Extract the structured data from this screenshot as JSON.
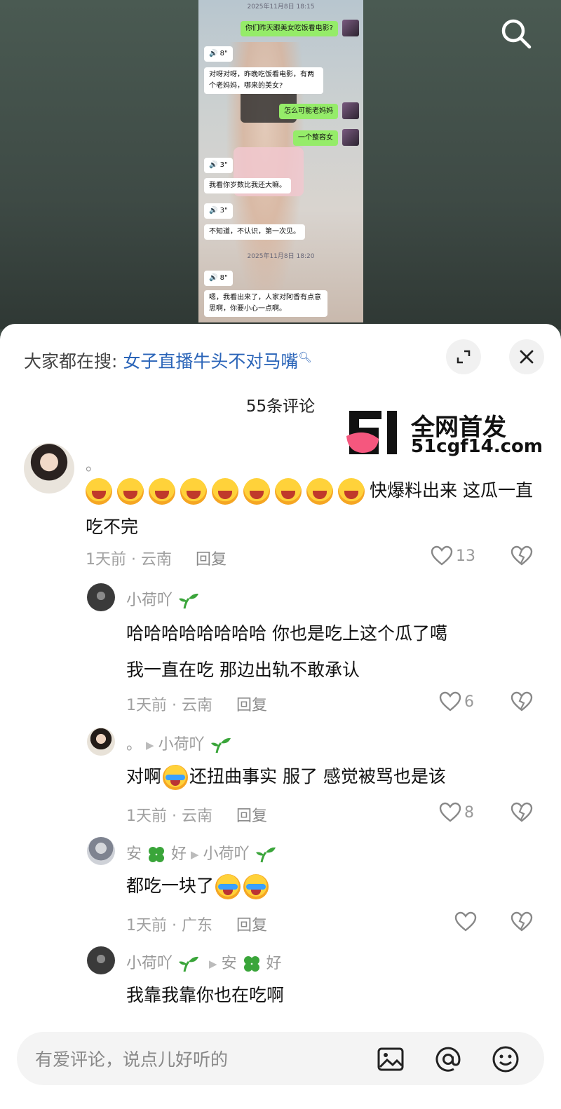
{
  "video": {
    "chat": {
      "timestamps": [
        "2025年11月8日 18:15",
        "2025年11月8日 18:20"
      ],
      "messages": [
        {
          "side": "right",
          "text": "你们昨天跟美女吃饭看电影?"
        },
        {
          "side": "left",
          "text": "🔊 8\""
        },
        {
          "side": "left",
          "text": "对呀对呀，昨晚吃饭看电影，有两个老妈妈，哪来的美女?"
        },
        {
          "side": "right",
          "text": "怎么可能老妈妈"
        },
        {
          "side": "right",
          "text": "一个整容女"
        },
        {
          "side": "left",
          "text": "🔊 3\""
        },
        {
          "side": "left",
          "text": "我看你岁数比我还大嘛。"
        },
        {
          "side": "left",
          "text": "🔊 3\""
        },
        {
          "side": "left",
          "text": "不知道，不认识，第一次见。"
        },
        {
          "side": "left",
          "text": "🔊 8\""
        },
        {
          "side": "left",
          "text": "嗯，我看出来了，人家对阿香有点意思啊，你要小心一点啊。"
        }
      ]
    }
  },
  "sheet": {
    "search_prefix": "大家都在搜:",
    "search_query": "女子直播牛头不对马嘴",
    "comment_count": "55条评论",
    "watermark": {
      "line1": "全网首发",
      "line2": "51cgf14.com"
    }
  },
  "comments": [
    {
      "username": "。",
      "text": "快爆料出来  这瓜一直吃不完",
      "emoji_count": 9,
      "time": "1天前 · 云南",
      "reply_label": "回复",
      "likes": "13"
    },
    {
      "username": "小荷吖",
      "text_line1": "哈哈哈哈哈哈哈哈  你也是吃上这个瓜了噶",
      "text_line2": "我一直在吃  那边出轨不敢承认",
      "time": "1天前 · 云南",
      "reply_label": "回复",
      "likes": "6"
    },
    {
      "username": "。",
      "reply_to": "小荷吖",
      "text_a": "对啊",
      "text_b": "还扭曲事实  服了  感觉被骂也是该",
      "time": "1天前 · 云南",
      "reply_label": "回复",
      "likes": "8"
    },
    {
      "username_a": "安",
      "username_b": "好",
      "reply_to": "小荷吖",
      "text": "都吃一块了",
      "time": "1天前 · 广东",
      "reply_label": "回复",
      "likes": ""
    },
    {
      "username": "小荷吖",
      "reply_to_a": "安",
      "reply_to_b": "好",
      "text": "我靠我靠你也在吃啊"
    }
  ],
  "input": {
    "placeholder": "有爱评论，说点儿好听的"
  },
  "colors": {
    "link_blue": "#2a64b8",
    "sprout_green": "#3aa53a",
    "chat_green": "#95ec69"
  }
}
